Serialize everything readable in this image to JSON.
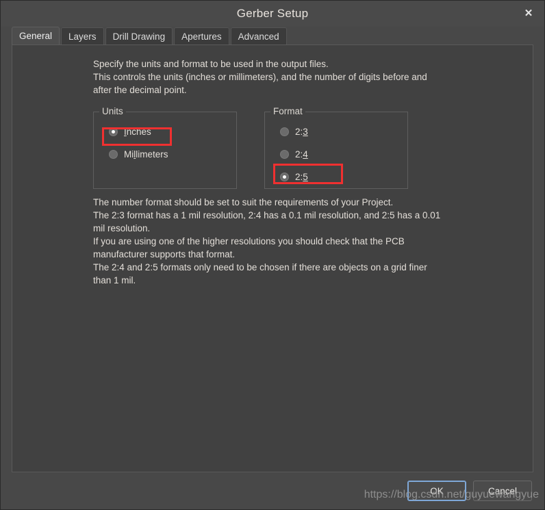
{
  "window": {
    "title": "Gerber Setup",
    "close_icon": "close-icon",
    "close_glyph": "✕"
  },
  "tabs": [
    {
      "label": "General",
      "active": true
    },
    {
      "label": "Layers",
      "active": false
    },
    {
      "label": "Drill Drawing",
      "active": false
    },
    {
      "label": "Apertures",
      "active": false
    },
    {
      "label": "Advanced",
      "active": false
    }
  ],
  "content": {
    "intro_text": "Specify the units and format to be used in the output files.\nThis controls the units (inches or millimeters), and the number of digits before and\nafter the decimal point.",
    "explain_text": "The number format should be set to suit the requirements of your Project.\nThe 2:3 format has a 1 mil resolution, 2:4 has a 0.1 mil resolution, and 2:5 has a 0.01\nmil resolution.\nIf you are using one of the higher resolutions you should check that the PCB\nmanufacturer supports that format.\nThe 2:4 and 2:5 formats only need to be chosen if there are objects on a grid finer\nthan 1 mil."
  },
  "units_group": {
    "label": "Units",
    "options": [
      {
        "label": "Inches",
        "accel_index": 0,
        "selected": true
      },
      {
        "label": "Millimeters",
        "accel_index": 2,
        "selected": false
      }
    ]
  },
  "format_group": {
    "label": "Format",
    "options": [
      {
        "label": "2:3",
        "accel_index": 2,
        "selected": false
      },
      {
        "label": "2:4",
        "accel_index": 2,
        "selected": false
      },
      {
        "label": "2:5",
        "accel_index": 2,
        "selected": true
      }
    ]
  },
  "footer": {
    "ok_label": "OK",
    "cancel_label": "Cancel",
    "watermark": "https://blog.csdn.net/guyuewangyue"
  },
  "colors": {
    "window_bg": "#484848",
    "panel_bg": "#414141",
    "titlebar_bg": "#4a4a4a",
    "tab_active_bg": "#4d4d4d",
    "tab_bg": "#3b3b3b",
    "text": "#e3ded8",
    "highlight_red": "#f03030",
    "focus_blue": "#7fa8d8"
  }
}
